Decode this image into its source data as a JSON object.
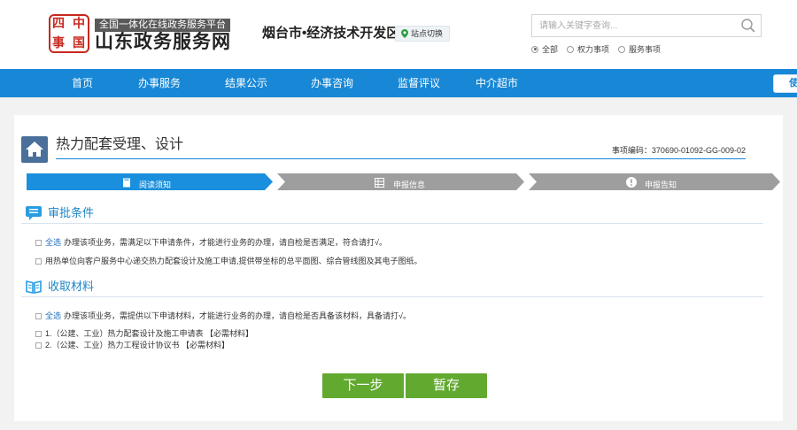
{
  "header": {
    "logo_seal_chars": [
      "四",
      "中",
      "事",
      "国"
    ],
    "slogan": "全国一体化在线政务服务平台",
    "site_name": "山东政务服务网",
    "region": "烟台市•经济技术开发区",
    "switch_label": "站点切换",
    "search_placeholder": "请输入关键字查询...",
    "search_scope": [
      {
        "label": "全部",
        "selected": true
      },
      {
        "label": "权力事项",
        "selected": false
      },
      {
        "label": "服务事项",
        "selected": false
      }
    ]
  },
  "nav": {
    "items": [
      "首页",
      "办事服务",
      "结果公示",
      "办事咨询",
      "监督评议",
      "中介超市"
    ],
    "right_label": "使"
  },
  "page": {
    "title": "热力配套受理、设计",
    "item_code": "事项编码：370690-01092-GG-009-02"
  },
  "steps": [
    {
      "label": "阅读须知",
      "icon": "document-icon",
      "active": true
    },
    {
      "label": "申报信息",
      "icon": "form-grid-icon",
      "active": false
    },
    {
      "label": "申报告知",
      "icon": "exclamation-icon",
      "active": false
    }
  ],
  "approval": {
    "title": "审批条件",
    "select_all": "全选",
    "intro": "办理该项业务，需满足以下申请条件，才能进行业务的办理，请自检是否满足，符合请打√。",
    "items": [
      "用热单位向客户服务中心递交热力配套设计及施工申请,提供带坐标的总平面图、综合管线图及其电子图纸。"
    ]
  },
  "materials": {
    "title": "收取材料",
    "select_all": "全选",
    "intro": "办理该项业务，需提供以下申请材料，才能进行业务的办理，请自检是否具备该材料，具备请打√。",
    "items": [
      "1.（公建、工业）热力配套设计及施工申请表 【必需材料】",
      "2.（公建、工业）热力工程设计协议书 【必需材料】"
    ]
  },
  "buttons": {
    "next": "下一步",
    "save": "暂存"
  },
  "colors": {
    "nav": "#1787d6",
    "step_active": "#1a8fdd",
    "step_inactive": "#9e9e9e",
    "button": "#62a930",
    "seal": "#c8281e"
  }
}
